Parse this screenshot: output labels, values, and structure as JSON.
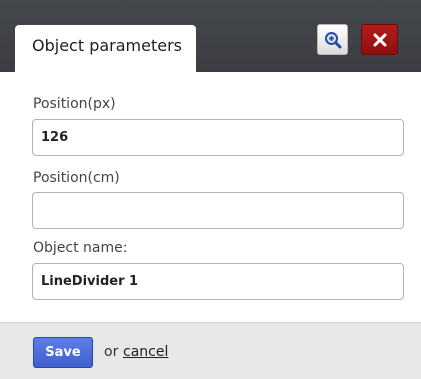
{
  "dialog": {
    "tab_title": "Object parameters",
    "buttons": {
      "zoom_icon": "zoom-in-icon",
      "close_icon": "close-icon"
    }
  },
  "fields": [
    {
      "label": "Position(px)",
      "value": "126",
      "placeholder": ""
    },
    {
      "label": "Position(cm)",
      "value": "",
      "placeholder": ""
    },
    {
      "label": "Object name:",
      "value": "LineDivider 1",
      "placeholder": ""
    }
  ],
  "footer": {
    "save_label": "Save",
    "or_text": "or",
    "cancel_label": "cancel"
  },
  "colors": {
    "titlebar": "#3f4247",
    "close_button": "#a31515",
    "save_button": "#4a6bdb",
    "footer": "#e8e8e8"
  }
}
